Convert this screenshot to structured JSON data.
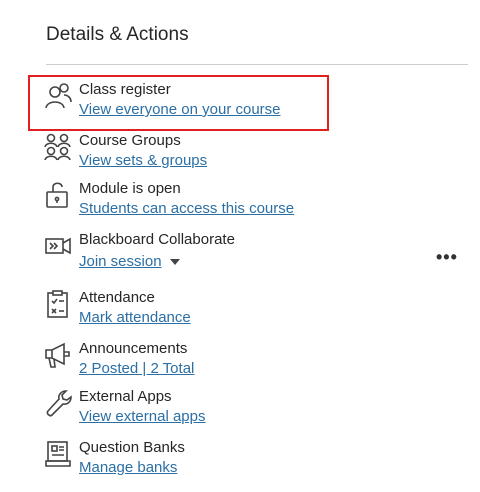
{
  "header": {
    "title": "Details & Actions"
  },
  "items": [
    {
      "label": "Class register",
      "link": "View everyone on your course",
      "icon": "people-icon"
    },
    {
      "label": "Course Groups",
      "link": "View sets & groups",
      "icon": "groups-icon"
    },
    {
      "label": "Module is open",
      "link": "Students can access this course",
      "icon": "unlocked-padlock-icon"
    },
    {
      "label": "Blackboard Collaborate",
      "link": "Join session",
      "icon": "video-camera-icon"
    },
    {
      "label": "Attendance",
      "link": "Mark attendance",
      "icon": "clipboard-checklist-icon"
    },
    {
      "label": "Announcements",
      "link": "2 Posted  |  2 Total",
      "icon": "megaphone-icon"
    },
    {
      "label": "External Apps",
      "link": "View external apps",
      "icon": "wrench-icon"
    },
    {
      "label": "Question Banks",
      "link": "Manage banks",
      "icon": "question-bank-icon"
    }
  ],
  "more_menu": {
    "glyph": "•••",
    "icon": "more-options-icon"
  },
  "colors": {
    "link": "#2b6fa5",
    "text": "#262626",
    "highlight": "#e01f1f"
  }
}
